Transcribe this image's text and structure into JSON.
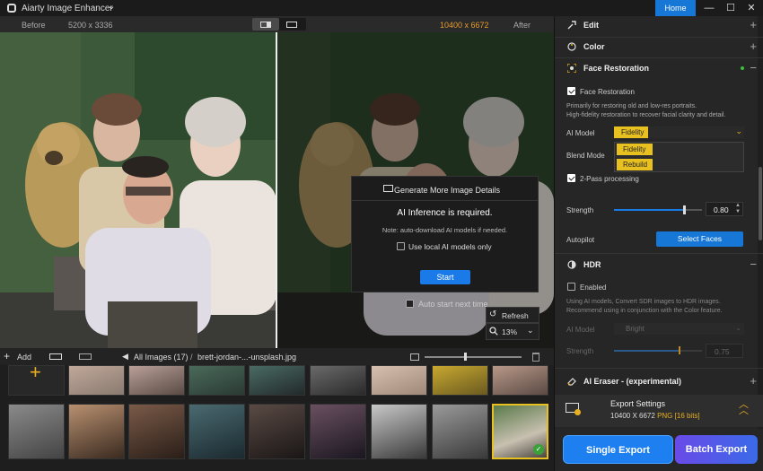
{
  "app": {
    "title": "Aiarty Image Enhancer",
    "home_label": "Home"
  },
  "window_controls": {
    "minimize": "—",
    "maximize": "☐",
    "close": "✕"
  },
  "compare": {
    "before_label": "Before",
    "before_dims": "5200 x 3336",
    "after_dims": "10400 x 6672",
    "after_label": "After"
  },
  "dialog": {
    "title": "Generate More Image Details",
    "required": "AI Inference is required.",
    "note": "Note: auto-download AI models if needed.",
    "use_local": "Use local AI models only",
    "start_label": "Start"
  },
  "auto_start": {
    "label": "Auto start next time",
    "checked": false
  },
  "refresh_label": "Refresh",
  "zoom": {
    "value": "13%"
  },
  "filmbar": {
    "add_label": "Add",
    "all_images": "All Images (17)",
    "separator": "/",
    "current_file": "brett-jordan-...-unsplash.jpg",
    "thumb_size": 0.4
  },
  "panel": {
    "edit": {
      "title": "Edit",
      "toggle": "+"
    },
    "color": {
      "title": "Color",
      "toggle": "+"
    },
    "face_restoration": {
      "title": "Face Restoration",
      "toggle": "−",
      "enable_label": "Face Restoration",
      "enabled": true,
      "desc1": "Primarily for restoring old and low-res portraits.",
      "desc2": "High-fidelity restoration to recover facial clarity and detail.",
      "ai_model_label": "AI Model",
      "ai_model_value": "Fidelity",
      "options": [
        "Fidelity",
        "Rebuild"
      ],
      "blend_mode_label": "Blend Mode",
      "two_pass_label": "2-Pass processing",
      "two_pass": true,
      "strength_label": "Strength",
      "strength_value": "0.80",
      "autopilot_label": "Autopilot",
      "select_faces_label": "Select Faces"
    },
    "hdr": {
      "title": "HDR",
      "toggle": "−",
      "enabled_label": "Enabled",
      "enabled": false,
      "desc1": "Using AI models, Convert SDR images to HDR images.",
      "desc2": "Recommend using in conjunction with the Color feature.",
      "ai_model_label": "AI Model",
      "ai_model_value": "Bright",
      "strength_label": "Strength",
      "strength_value": "0.75"
    },
    "ai_eraser": {
      "title": "AI Eraser - (experimental)",
      "toggle": "+"
    },
    "export": {
      "title": "Export Settings",
      "dims": "10400 X 6672",
      "format": "PNG",
      "bits": "[16 bits]"
    },
    "single_export": "Single Export",
    "batch_export": "Batch Export"
  },
  "colors": {
    "accent": "#1677d6",
    "highlight": "#e8c020",
    "panel_bg": "#262626"
  }
}
